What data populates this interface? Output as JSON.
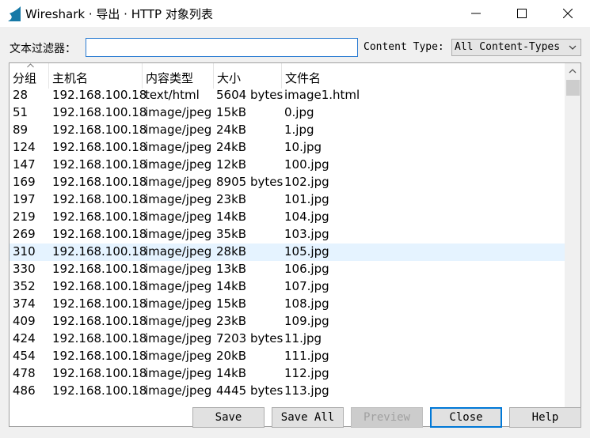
{
  "window": {
    "title": "Wireshark · 导出 · HTTP 对象列表",
    "app_icon": "wireshark-fin-icon",
    "controls": [
      "minimize-icon",
      "maximize-icon",
      "close-icon"
    ]
  },
  "filter": {
    "label": "文本过滤器：",
    "value": "",
    "placeholder": ""
  },
  "content_type": {
    "label": "Content Type:",
    "selected": "All Content-Types"
  },
  "table": {
    "columns": [
      "分组",
      "主机名",
      "内容类型",
      "大小",
      "文件名"
    ],
    "sort_column": "分组",
    "selected_row": 9,
    "rows": [
      [
        "28",
        "192.168.100.18",
        "text/html",
        "5604 bytes",
        "image1.html"
      ],
      [
        "51",
        "192.168.100.18",
        "image/jpeg",
        "15kB",
        "0.jpg"
      ],
      [
        "89",
        "192.168.100.18",
        "image/jpeg",
        "24kB",
        "1.jpg"
      ],
      [
        "124",
        "192.168.100.18",
        "image/jpeg",
        "24kB",
        "10.jpg"
      ],
      [
        "147",
        "192.168.100.18",
        "image/jpeg",
        "12kB",
        "100.jpg"
      ],
      [
        "169",
        "192.168.100.18",
        "image/jpeg",
        "8905 bytes",
        "102.jpg"
      ],
      [
        "197",
        "192.168.100.18",
        "image/jpeg",
        "23kB",
        "101.jpg"
      ],
      [
        "219",
        "192.168.100.18",
        "image/jpeg",
        "14kB",
        "104.jpg"
      ],
      [
        "269",
        "192.168.100.18",
        "image/jpeg",
        "35kB",
        "103.jpg"
      ],
      [
        "310",
        "192.168.100.18",
        "image/jpeg",
        "28kB",
        "105.jpg"
      ],
      [
        "330",
        "192.168.100.18",
        "image/jpeg",
        "13kB",
        "106.jpg"
      ],
      [
        "352",
        "192.168.100.18",
        "image/jpeg",
        "14kB",
        "107.jpg"
      ],
      [
        "374",
        "192.168.100.18",
        "image/jpeg",
        "15kB",
        "108.jpg"
      ],
      [
        "409",
        "192.168.100.18",
        "image/jpeg",
        "23kB",
        "109.jpg"
      ],
      [
        "424",
        "192.168.100.18",
        "image/jpeg",
        "7203 bytes",
        "11.jpg"
      ],
      [
        "454",
        "192.168.100.18",
        "image/jpeg",
        "20kB",
        "111.jpg"
      ],
      [
        "478",
        "192.168.100.18",
        "image/jpeg",
        "14kB",
        "112.jpg"
      ],
      [
        "486",
        "192.168.100.18",
        "image/jpeg",
        "4445 bytes",
        "113.jpg"
      ]
    ]
  },
  "buttons": {
    "save": "Save",
    "save_all": "Save All",
    "preview": "Preview",
    "close": "Close",
    "help": "Help"
  },
  "colors": {
    "selection": "#e5f3ff",
    "focus_border": "#2d7dd2",
    "default_button_border": "#0078d7"
  }
}
